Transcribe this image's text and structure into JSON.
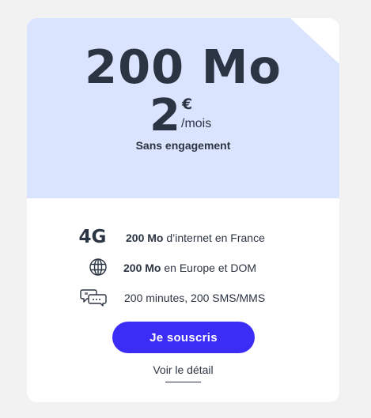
{
  "offer": {
    "data_amount": "200 Mo",
    "price_value": "2",
    "price_currency": "€",
    "price_period": "/mois",
    "commitment": "Sans engagement"
  },
  "features": [
    {
      "icon": "4g-icon",
      "icon_label": "4G",
      "bold": "200 Mo",
      "text": " d’internet en France"
    },
    {
      "icon": "globe-icon",
      "bold": "200 Mo",
      "text": " en Europe et DOM"
    },
    {
      "icon": "sms-chat-icon",
      "bold": "",
      "text": "200 minutes, 200 SMS/MMS"
    }
  ],
  "actions": {
    "subscribe_label": "Je souscris",
    "detail_label": "Voir le détail"
  },
  "colors": {
    "header_bg": "#dbe4fe",
    "accent": "#3b2cf6",
    "text": "#2b3442",
    "page_bg": "#f2f2f3"
  }
}
